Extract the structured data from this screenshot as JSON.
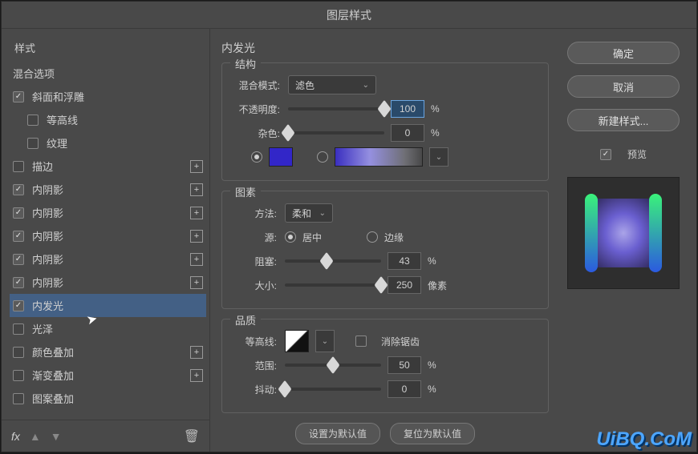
{
  "title": "图层样式",
  "sidebar": {
    "header": "样式",
    "blending": "混合选项",
    "items": [
      {
        "label": "斜面和浮雕",
        "checked": true,
        "indent": false,
        "add": false
      },
      {
        "label": "等高线",
        "checked": false,
        "indent": true,
        "add": false
      },
      {
        "label": "纹理",
        "checked": false,
        "indent": true,
        "add": false
      },
      {
        "label": "描边",
        "checked": false,
        "indent": false,
        "add": true
      },
      {
        "label": "内阴影",
        "checked": true,
        "indent": false,
        "add": true
      },
      {
        "label": "内阴影",
        "checked": true,
        "indent": false,
        "add": true
      },
      {
        "label": "内阴影",
        "checked": true,
        "indent": false,
        "add": true
      },
      {
        "label": "内阴影",
        "checked": true,
        "indent": false,
        "add": true
      },
      {
        "label": "内阴影",
        "checked": true,
        "indent": false,
        "add": true
      },
      {
        "label": "内发光",
        "checked": true,
        "indent": false,
        "add": false,
        "selected": true
      },
      {
        "label": "光泽",
        "checked": false,
        "indent": false,
        "add": false
      },
      {
        "label": "颜色叠加",
        "checked": false,
        "indent": false,
        "add": true
      },
      {
        "label": "渐变叠加",
        "checked": false,
        "indent": false,
        "add": true
      },
      {
        "label": "图案叠加",
        "checked": false,
        "indent": false,
        "add": false
      }
    ],
    "fx": "fx"
  },
  "panel": {
    "title": "内发光",
    "structure": {
      "title": "结构",
      "blend_mode_label": "混合模式:",
      "blend_mode_value": "滤色",
      "opacity_label": "不透明度:",
      "opacity_value": "100",
      "opacity_unit": "%",
      "noise_label": "杂色:",
      "noise_value": "0",
      "noise_unit": "%",
      "solid_color": "#3226c8"
    },
    "elements": {
      "title": "图素",
      "technique_label": "方法:",
      "technique_value": "柔和",
      "source_label": "源:",
      "source_center": "居中",
      "source_edge": "边缘",
      "choke_label": "阻塞:",
      "choke_value": "43",
      "choke_unit": "%",
      "size_label": "大小:",
      "size_value": "250",
      "size_unit": "像素"
    },
    "quality": {
      "title": "品质",
      "contour_label": "等高线:",
      "antialias_label": "消除锯齿",
      "range_label": "范围:",
      "range_value": "50",
      "range_unit": "%",
      "jitter_label": "抖动:",
      "jitter_value": "0",
      "jitter_unit": "%"
    },
    "make_default": "设置为默认值",
    "reset_default": "复位为默认值"
  },
  "right": {
    "ok": "确定",
    "cancel": "取消",
    "new_style": "新建样式...",
    "preview_label": "预览"
  },
  "watermark": "UiBQ.CoM"
}
